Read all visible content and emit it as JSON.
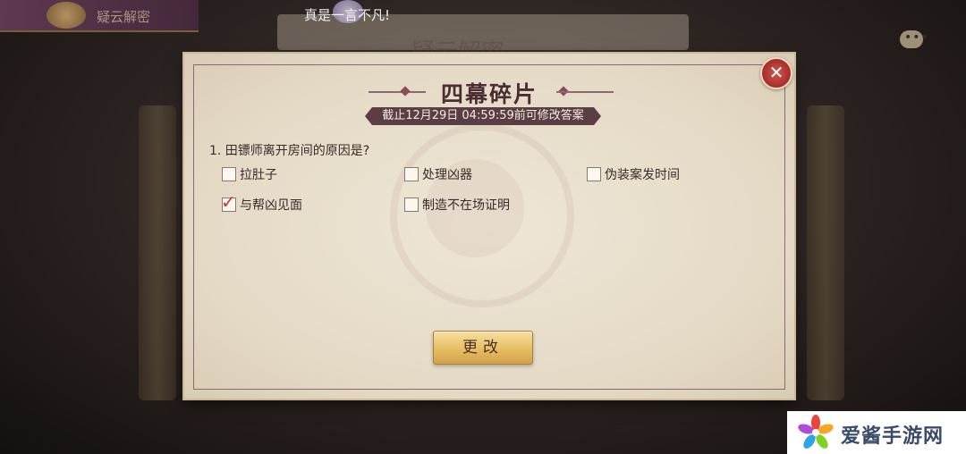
{
  "background": {
    "tab_label": "疑云解密",
    "subline": "",
    "top_message": "真是一言不凡!",
    "scroll_title": "疑云解密",
    "bottom_hint": ""
  },
  "dialog": {
    "title": "四幕碎片",
    "deadline": "截止12月29日 04:59:59前可修改答案",
    "question": "1. 田镖师离开房间的原因是?",
    "options": [
      {
        "label": "拉肚子",
        "checked": false
      },
      {
        "label": "处理凶器",
        "checked": false
      },
      {
        "label": "伪装案发时间",
        "checked": false
      },
      {
        "label": "与帮凶见面",
        "checked": true
      },
      {
        "label": "制造不在场证明",
        "checked": false
      }
    ],
    "confirm_label": "更改",
    "close_glyph": "✕",
    "check_glyph": "✓"
  },
  "watermark_logo": {
    "text": "爱酱手游网",
    "color": "#3a4a6a"
  },
  "colors": {
    "panel": "#ebe2d2",
    "accent_dark": "#5a3e44",
    "button_gold": "#e6bd62",
    "close_red": "#c8302a",
    "check_red": "#c03a30"
  }
}
